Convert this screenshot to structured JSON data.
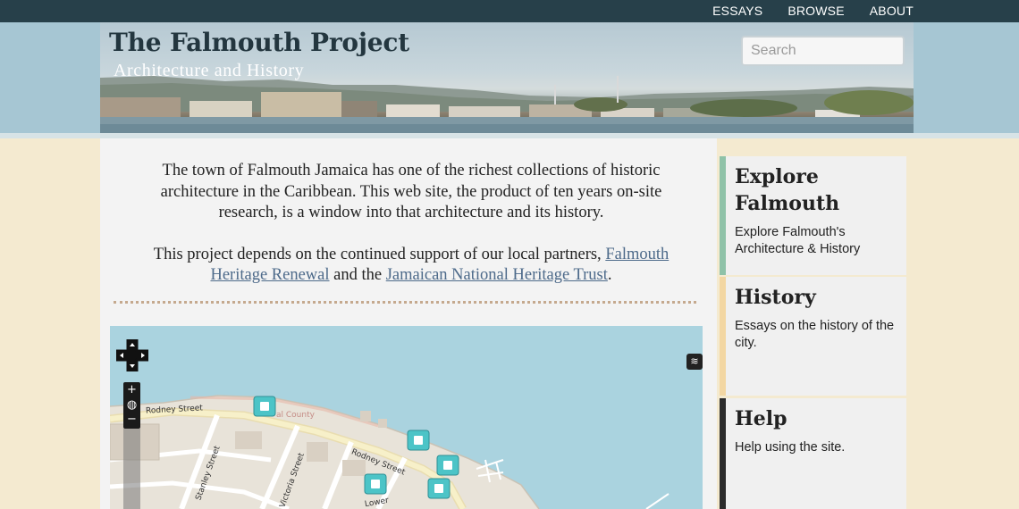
{
  "nav": {
    "items": [
      {
        "label": "ESSAYS"
      },
      {
        "label": "BROWSE"
      },
      {
        "label": "ABOUT"
      }
    ]
  },
  "header": {
    "title": "The Falmouth Project",
    "subtitle": "Architecture and History"
  },
  "search": {
    "placeholder": "Search"
  },
  "intro": {
    "p1": "The town of Falmouth Jamaica has one of the richest collections of historic architecture in the Caribbean. This web site, the product of ten years on-site research, is a window into that architecture and its history.",
    "p2_before": "This project depends on the continued support of our local partners, ",
    "link1": "Falmouth Heritage Renewal",
    "p2_middle": " and the ",
    "link2": "Jamaican National Heritage Trust",
    "p2_after": "."
  },
  "map": {
    "zoom_in": "+",
    "zoom_out": "−",
    "streets": [
      "Rodney Street",
      "Rodney Street",
      "Stanley Street",
      "Victoria Street",
      "Lower",
      "al County"
    ]
  },
  "sidebar": {
    "cards": [
      {
        "title": "Explore Falmouth",
        "desc": "Explore Falmouth's Architecture & History",
        "color": "#8fc2a8"
      },
      {
        "title": "History",
        "desc": "Essays on the history of the city.",
        "color": "#f3d7a3"
      },
      {
        "title": "Help",
        "desc": "Help using the site.",
        "color": "#2b2b2b"
      }
    ]
  }
}
